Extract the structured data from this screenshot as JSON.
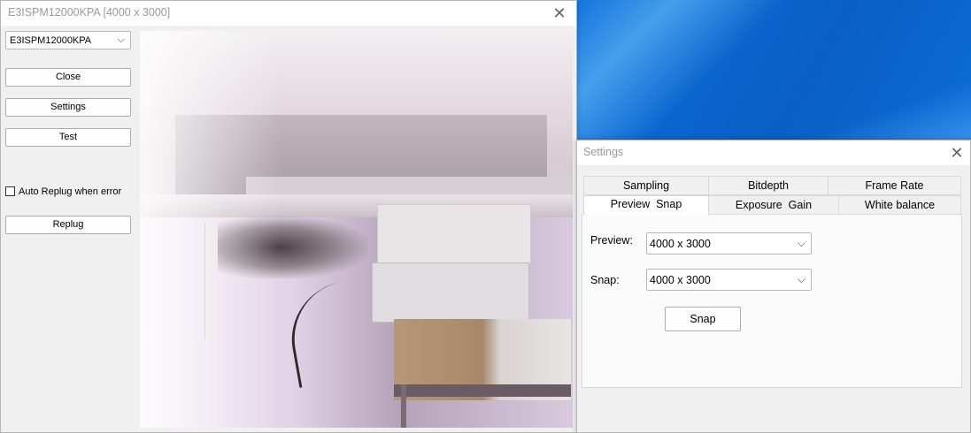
{
  "camera_window": {
    "title": "E3ISPM12000KPA [4000 x 3000]",
    "close_glyph": "✕",
    "device_select": {
      "value": "E3ISPM12000KPA",
      "chevron": "⌵"
    },
    "buttons": {
      "close": "Close",
      "settings": "Settings",
      "test": "Test",
      "replug": "Replug"
    },
    "auto_replug": {
      "label": "Auto Replug when error",
      "checked": false
    }
  },
  "settings_window": {
    "title": "Settings",
    "close_glyph": "✕",
    "tabs_row1": [
      "Sampling",
      "Bitdepth",
      "Frame Rate"
    ],
    "tabs_row2": [
      "Preview  Snap",
      "Exposure  Gain",
      "White balance"
    ],
    "active_tab": "Preview  Snap",
    "preview": {
      "label": "Preview:",
      "value": "4000 x 3000",
      "chevron": "⌵"
    },
    "snap": {
      "label": "Snap:",
      "value": "4000 x 3000",
      "chevron": "⌵"
    },
    "snap_button": "Snap"
  },
  "colors": {
    "wallpaper": "#0a63c9",
    "window_bg": "#f0f0f0",
    "title_text": "#9a9a9a"
  }
}
